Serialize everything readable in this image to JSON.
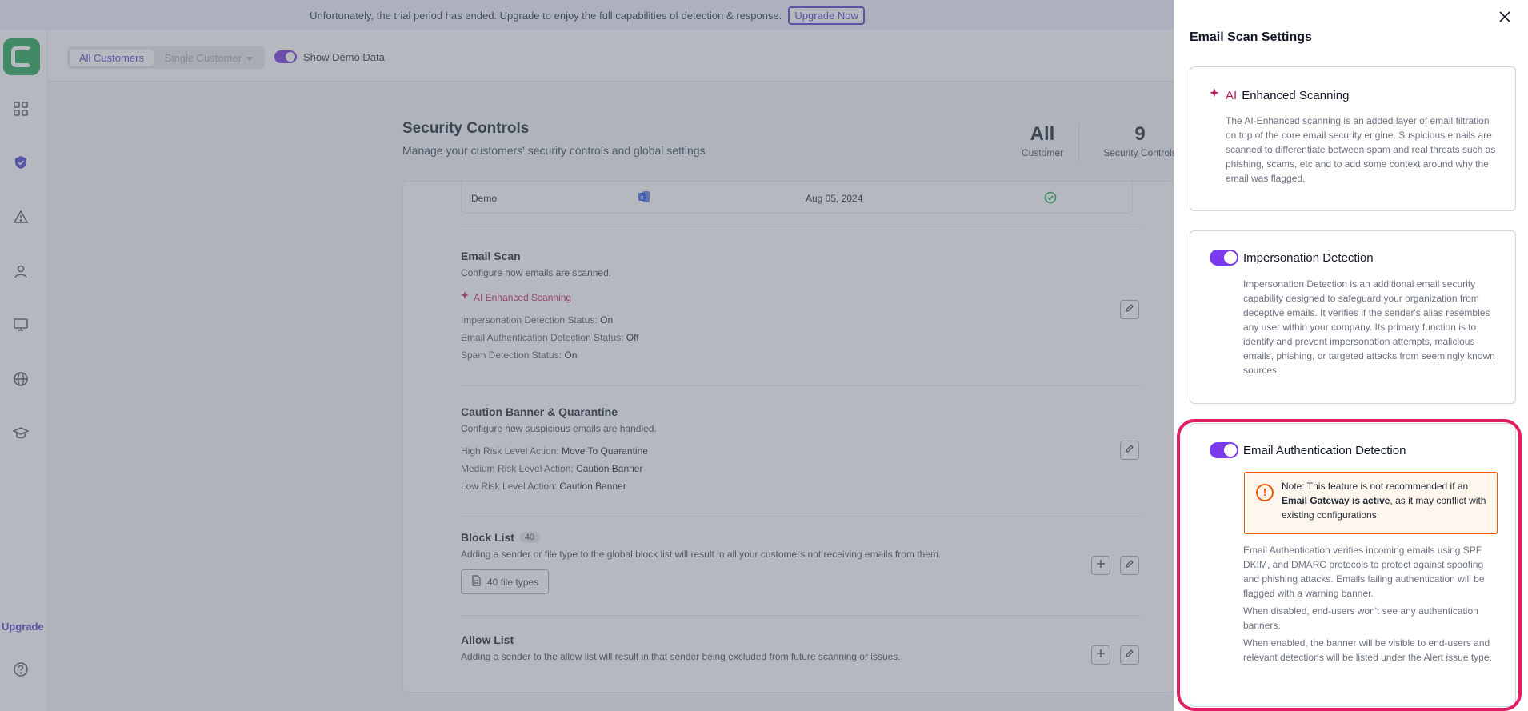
{
  "banner": {
    "message": "Unfortunately, the trial period has ended. Upgrade to enjoy the full capabilities of detection & response.",
    "upgrade_label": "Upgrade Now"
  },
  "leftnav": {
    "upgrade_label": "Upgrade",
    "icons": [
      "dashboard-icon",
      "shield-icon",
      "alert-icon",
      "user-icon",
      "monitor-icon",
      "globe-icon",
      "graduation-cap-icon",
      "help-icon"
    ]
  },
  "topbar": {
    "all_customers": "All Customers",
    "single_customer": "Single Customer",
    "show_demo": "Show Demo Data"
  },
  "page": {
    "title": "Security Controls",
    "subtitle": "Manage your customers' security controls and global settings",
    "stats": [
      {
        "value": "All",
        "label": "Customer"
      },
      {
        "value": "9",
        "label": "Security Controls"
      }
    ]
  },
  "demo_row": {
    "name": "Demo",
    "date": "Aug 05, 2024"
  },
  "email_scan": {
    "title": "Email Scan",
    "desc": "Configure how emails are scanned.",
    "ai_label": "AI Enhanced Scanning",
    "impersonation_label": "Impersonation Detection Status:",
    "impersonation_value": "On",
    "auth_label": "Email Authentication Detection Status:",
    "auth_value": "Off",
    "spam_label": "Spam Detection Status:",
    "spam_value": "On"
  },
  "caution": {
    "title": "Caution Banner & Quarantine",
    "desc": "Configure how suspicious emails are handled.",
    "high_label": "High Risk Level Action:",
    "high_value": "Move To Quarantine",
    "medium_label": "Medium Risk Level Action:",
    "medium_value": "Caution Banner",
    "low_label": "Low Risk Level Action:",
    "low_value": "Caution Banner"
  },
  "block_list": {
    "title": "Block List",
    "count": "40",
    "desc": "Adding a sender or file type to the global block list will result in all your customers not receiving emails from them.",
    "file_types": "40 file types"
  },
  "allow_list": {
    "title": "Allow List",
    "desc": "Adding a sender to the allow list will result in that sender being excluded from future scanning or issues.."
  },
  "drawer": {
    "title": "Email Scan Settings",
    "ai": {
      "ai_tag": "AI",
      "title": "Enhanced Scanning",
      "desc": "The AI-Enhanced scanning is an added layer of email filtration on top of the core email security engine. Suspicious emails are scanned to differentiate between spam and real threats such as phishing, scams, etc and to add some context around why the email was flagged."
    },
    "impersonation": {
      "title": "Impersonation Detection",
      "enabled": true,
      "desc": "Impersonation Detection is an additional email security capability designed to safeguard your organization from deceptive emails. It verifies if the sender's alias resembles any user within your company. Its primary function is to identify and prevent impersonation attempts, malicious emails, phishing, or targeted attacks from seemingly known sources."
    },
    "auth": {
      "title": "Email Authentication Detection",
      "enabled": true,
      "note_pre": "Note: This feature is not recommended if an ",
      "note_bold": "Email Gateway is active",
      "note_post": ", as it may conflict with existing configurations.",
      "desc1": "Email Authentication verifies incoming emails using SPF, DKIM, and DMARC protocols to protect against spoofing and phishing attacks. Emails failing authentication will be flagged with a warning banner.",
      "desc2": "When disabled, end-users won't see any authentication banners.",
      "desc3": "When enabled, the banner will be visible to end-users and relevant detections will be listed under the Alert issue type."
    }
  },
  "colors": {
    "accent": "#4338ca",
    "toggle": "#7c3aed",
    "ai": "#be185d",
    "warning": "#ea580c",
    "highlight": "#e11d63",
    "success": "#16a34a"
  }
}
